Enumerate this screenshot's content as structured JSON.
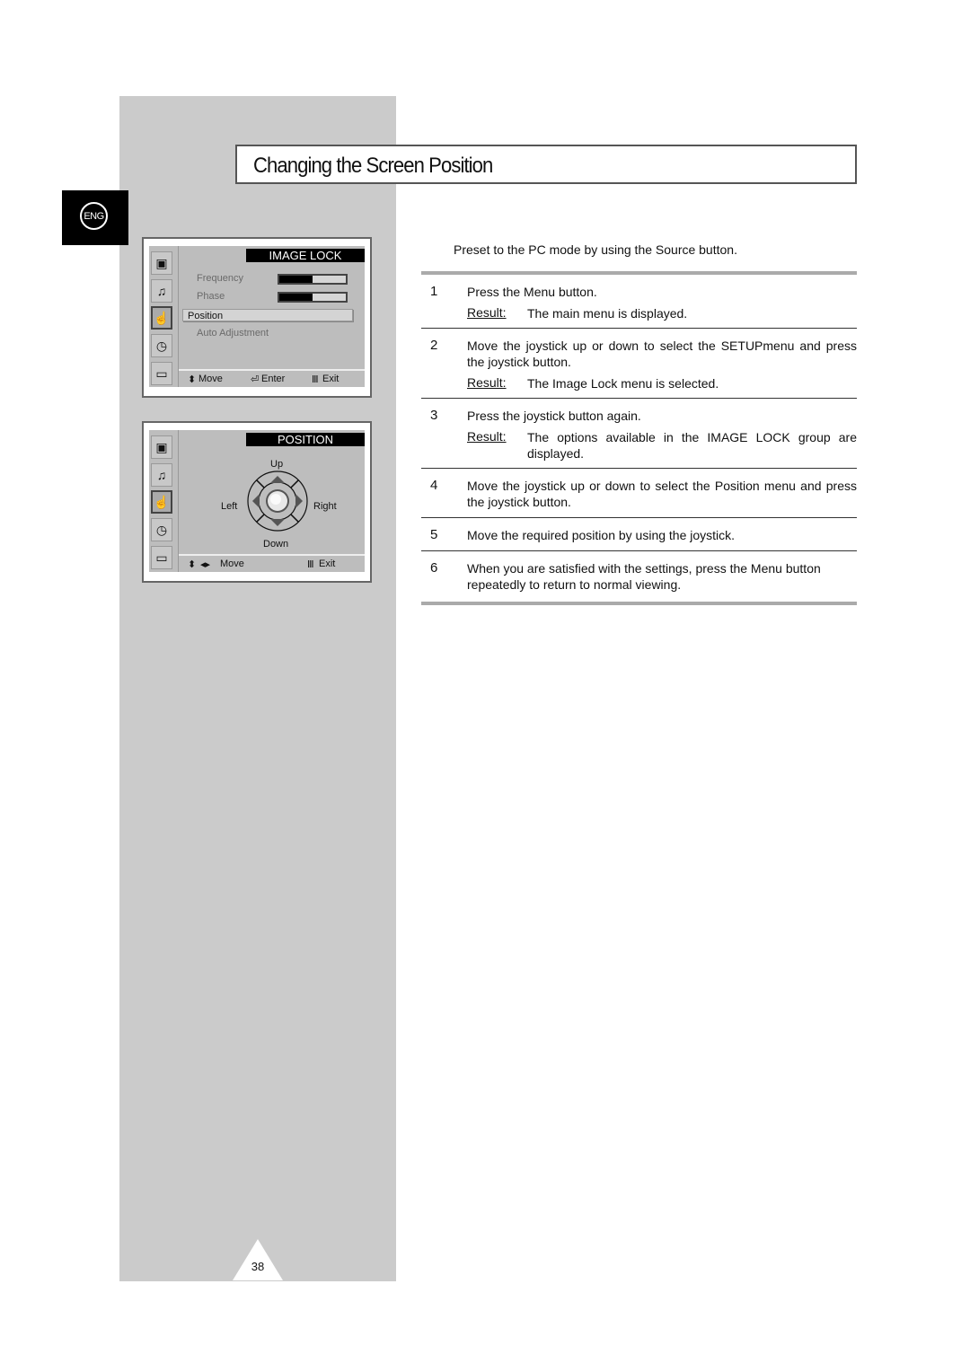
{
  "page": {
    "title": "Changing the Screen Position",
    "language_badge": "ENG",
    "page_number": "38"
  },
  "osd_image_lock": {
    "header": "IMAGE LOCK",
    "tabs": [
      "picture-icon",
      "sound-icon",
      "setup-icon",
      "timer-icon",
      "pip-icon"
    ],
    "active_tab": 2,
    "items": [
      {
        "label": "Frequency",
        "bar_fraction": 0.5
      },
      {
        "label": "Phase",
        "bar_fraction": 0.5
      },
      {
        "label": "Position",
        "selected": true
      },
      {
        "label": "Auto Adjustment"
      }
    ],
    "footer": {
      "move": "Move",
      "enter": "Enter",
      "exit": "Exit"
    }
  },
  "osd_position": {
    "header": "POSITION",
    "tabs": [
      "picture-icon",
      "sound-icon",
      "setup-icon",
      "timer-icon",
      "pip-icon"
    ],
    "active_tab": 2,
    "directions": {
      "up": "Up",
      "down": "Down",
      "left": "Left",
      "right": "Right"
    },
    "footer": {
      "move": "Move",
      "exit": "Exit"
    }
  },
  "instructions": {
    "intro": "Preset to the PC mode by using the Source  button.",
    "result_label": "Result:",
    "steps": [
      {
        "num": "1",
        "text": "Press the Menu  button.",
        "result": "The main menu is displayed."
      },
      {
        "num": "2",
        "text": "Move the joystick up or down to select the SETUPmenu and press the joystick button.",
        "result": "The Image Lock   menu is selected."
      },
      {
        "num": "3",
        "text": "Press the joystick button again.",
        "result": "The options available in the IMAGE LOCK group are displayed."
      },
      {
        "num": "4",
        "text": "Move the joystick up or down to select the Position    menu and press the joystick button."
      },
      {
        "num": "5",
        "text": "Move the required position by using the joystick."
      },
      {
        "num": "6",
        "text": "When you are satisfied with the settings, press the Menu button repeatedly to return to normal viewing."
      }
    ]
  }
}
